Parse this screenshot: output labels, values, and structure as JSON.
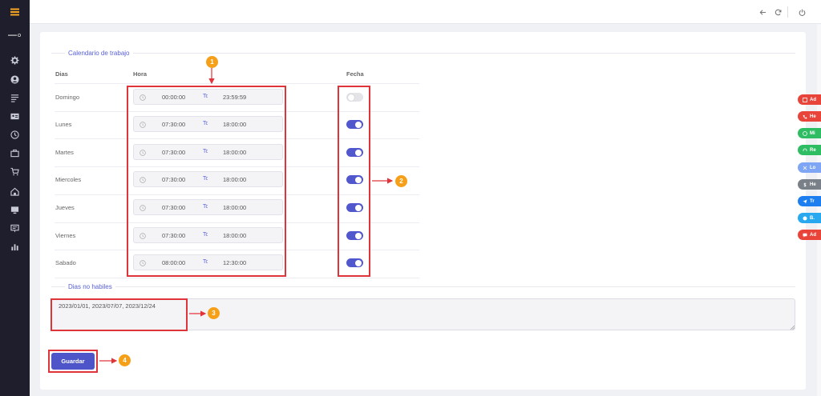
{
  "sidebar": {
    "menu_icon": "hamburger-menu-icon",
    "logo_icon": "brand-logo-icon",
    "icons": [
      "gear-icon",
      "user-circle-icon",
      "document-list-icon",
      "id-card-icon",
      "history-clock-icon",
      "briefcase-icon",
      "cart-icon",
      "house-icon",
      "monitor-icon",
      "screen-icon",
      "bar-chart-icon"
    ]
  },
  "topbar": {
    "icons": [
      "back-arrow-icon",
      "refresh-icon",
      "power-icon"
    ]
  },
  "calendar": {
    "legend": "Calendario de trabajo",
    "headers": {
      "days": "Dias",
      "hour": "Hora",
      "date": "Fecha"
    },
    "rows": [
      {
        "day": "Domingo",
        "from": "00:00:00",
        "to_label": "To",
        "to": "23:59:59",
        "enabled": false
      },
      {
        "day": "Lunes",
        "from": "07:30:00",
        "to_label": "To",
        "to": "18:00:00",
        "enabled": true
      },
      {
        "day": "Martes",
        "from": "07:30:00",
        "to_label": "To",
        "to": "18:00:00",
        "enabled": true
      },
      {
        "day": "Miercoles",
        "from": "07:30:00",
        "to_label": "To",
        "to": "18:00:00",
        "enabled": true
      },
      {
        "day": "Jueves",
        "from": "07:30:00",
        "to_label": "To",
        "to": "18:00:00",
        "enabled": true
      },
      {
        "day": "Viernes",
        "from": "07:30:00",
        "to_label": "To",
        "to": "18:00:00",
        "enabled": true
      },
      {
        "day": "Sabado",
        "from": "08:00:00",
        "to_label": "To",
        "to": "12:30:00",
        "enabled": true
      }
    ]
  },
  "holidays": {
    "legend": "Dias no habiles",
    "value": "2023/01/01, 2023/07/07, 2023/12/24"
  },
  "save_button": {
    "label": "Guardar"
  },
  "annotations": [
    "1",
    "2",
    "3",
    "4"
  ],
  "float_tabs": [
    {
      "label": "Ad",
      "color": "#e8443a",
      "icon": "edit-icon"
    },
    {
      "label": "He",
      "color": "#e8443a",
      "icon": "phone-icon"
    },
    {
      "label": "Mi",
      "color": "#2ebd62",
      "icon": "whatsapp-icon"
    },
    {
      "label": "Re",
      "color": "#2ebd62",
      "icon": "headset-icon"
    },
    {
      "label": "Lo",
      "color": "#7fa6f5",
      "icon": "close-icon"
    },
    {
      "label": "He",
      "color": "#7a8088",
      "icon": "dollar-icon"
    },
    {
      "label": "Tr",
      "color": "#1d7ef0",
      "icon": "send-icon"
    },
    {
      "label": "B.",
      "color": "#28a8ee",
      "icon": "globe-icon"
    },
    {
      "label": "Ad",
      "color": "#e8443a",
      "icon": "chat-icon"
    }
  ],
  "colors": {
    "accent": "#5157cc",
    "annotation_red": "#e0343b",
    "annotation_badge": "#f5a018",
    "sidebar_bg": "#1e1e2d",
    "menu_orange": "#f5a623"
  }
}
